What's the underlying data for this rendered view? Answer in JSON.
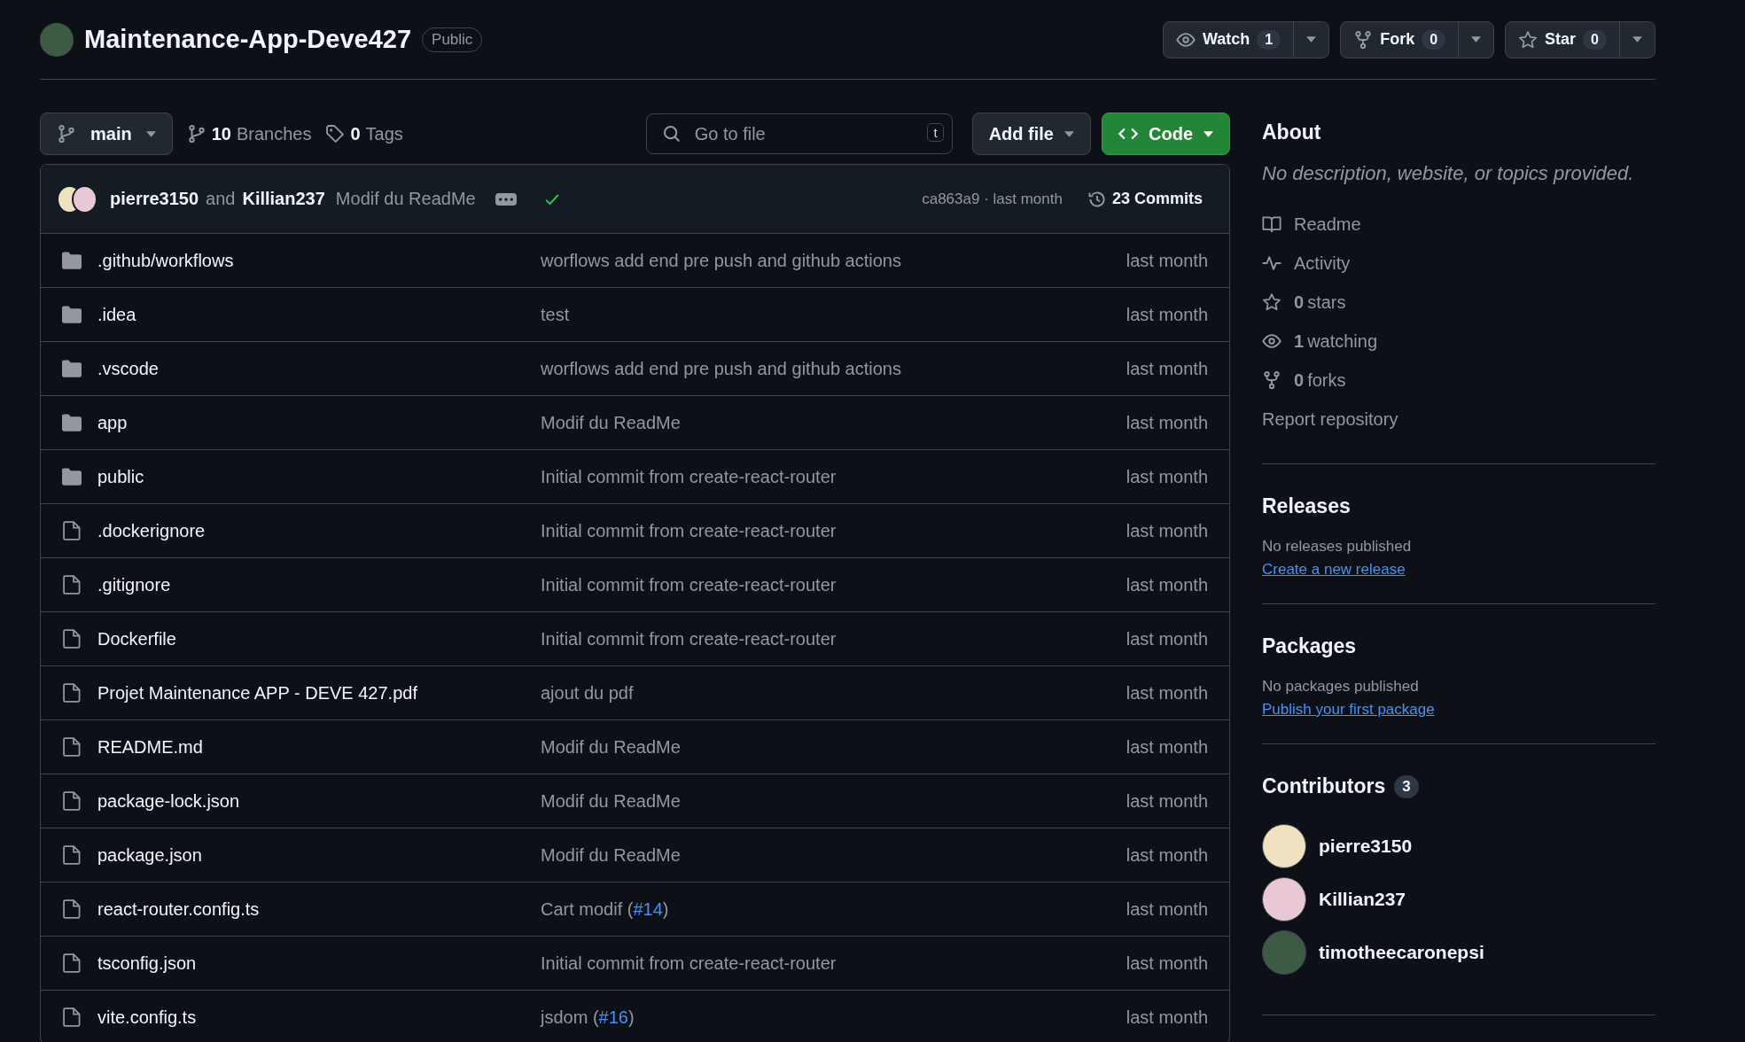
{
  "repo": {
    "name": "Maintenance-App-Deve427",
    "visibility": "Public"
  },
  "actions": [
    {
      "kind": "watch",
      "label": "Watch",
      "count": "1"
    },
    {
      "kind": "fork",
      "label": "Fork",
      "count": "0"
    },
    {
      "kind": "star",
      "label": "Star",
      "count": "0"
    }
  ],
  "toolbar": {
    "branch": "main",
    "branches_count": "10",
    "branches_label": "Branches",
    "tags_count": "0",
    "tags_label": "Tags",
    "search": {
      "placeholder": "Go to file",
      "shortcut": "t"
    },
    "add_file": "Add file",
    "code": "Code"
  },
  "latest_commit": {
    "author1": "pierre3150",
    "joiner": "and",
    "author2": "Killian237",
    "message": "Modif du ReadMe",
    "status_ok": true,
    "sha_time": "ca863a9 · last month",
    "commits": "23 Commits"
  },
  "files": [
    {
      "kind": "folder",
      "name": ".github/workflows",
      "message": "worflows add end pre push and github actions",
      "time": "last month"
    },
    {
      "kind": "folder",
      "name": ".idea",
      "message": "test",
      "time": "last month"
    },
    {
      "kind": "folder",
      "name": ".vscode",
      "message": "worflows add end pre push and github actions",
      "time": "last month"
    },
    {
      "kind": "folder",
      "name": "app",
      "message": "Modif du ReadMe",
      "time": "last month"
    },
    {
      "kind": "folder",
      "name": "public",
      "message": "Initial commit from create-react-router",
      "time": "last month"
    },
    {
      "kind": "file",
      "name": ".dockerignore",
      "message": "Initial commit from create-react-router",
      "time": "last month"
    },
    {
      "kind": "file",
      "name": ".gitignore",
      "message": "Initial commit from create-react-router",
      "time": "last month"
    },
    {
      "kind": "file",
      "name": "Dockerfile",
      "message": "Initial commit from create-react-router",
      "time": "last month"
    },
    {
      "kind": "file",
      "name": "Projet Maintenance APP - DEVE 427.pdf",
      "message": "ajout du pdf",
      "time": "last month"
    },
    {
      "kind": "file",
      "name": "README.md",
      "message": "Modif du ReadMe",
      "time": "last month"
    },
    {
      "kind": "file",
      "name": "package-lock.json",
      "message": "Modif du ReadMe",
      "time": "last month"
    },
    {
      "kind": "file",
      "name": "package.json",
      "message": "Modif du ReadMe",
      "time": "last month"
    },
    {
      "kind": "file",
      "name": "react-router.config.ts",
      "message": "Cart modif (",
      "pr": "#14",
      "message_end": ")",
      "time": "last month"
    },
    {
      "kind": "file",
      "name": "tsconfig.json",
      "message": "Initial commit from create-react-router",
      "time": "last month"
    },
    {
      "kind": "file",
      "name": "vite.config.ts",
      "message": "jsdom (",
      "pr": "#16",
      "message_end": ")",
      "time": "last month"
    }
  ],
  "about": {
    "title": "About",
    "description": "No description, website, or topics provided.",
    "items": [
      {
        "kind": "book",
        "label": "Readme"
      },
      {
        "kind": "pulse",
        "label": "Activity"
      },
      {
        "kind": "star",
        "count": "0",
        "label": "stars"
      },
      {
        "kind": "eye",
        "count": "1",
        "label": "watching"
      },
      {
        "kind": "fork",
        "count": "0",
        "label": "forks"
      }
    ],
    "report": "Report repository"
  },
  "releases": {
    "title": "Releases",
    "text": "No releases published",
    "link": "Create a new release"
  },
  "packages": {
    "title": "Packages",
    "text": "No packages published",
    "link": "Publish your first package"
  },
  "contributors": {
    "title": "Contributors",
    "count": "3",
    "people": [
      {
        "name": "pierre3150",
        "color": "#f0e2c0"
      },
      {
        "name": "Killian237",
        "color": "#e8c8d4"
      },
      {
        "name": "timotheecaronepsi",
        "color": "#3d5a44"
      }
    ]
  }
}
